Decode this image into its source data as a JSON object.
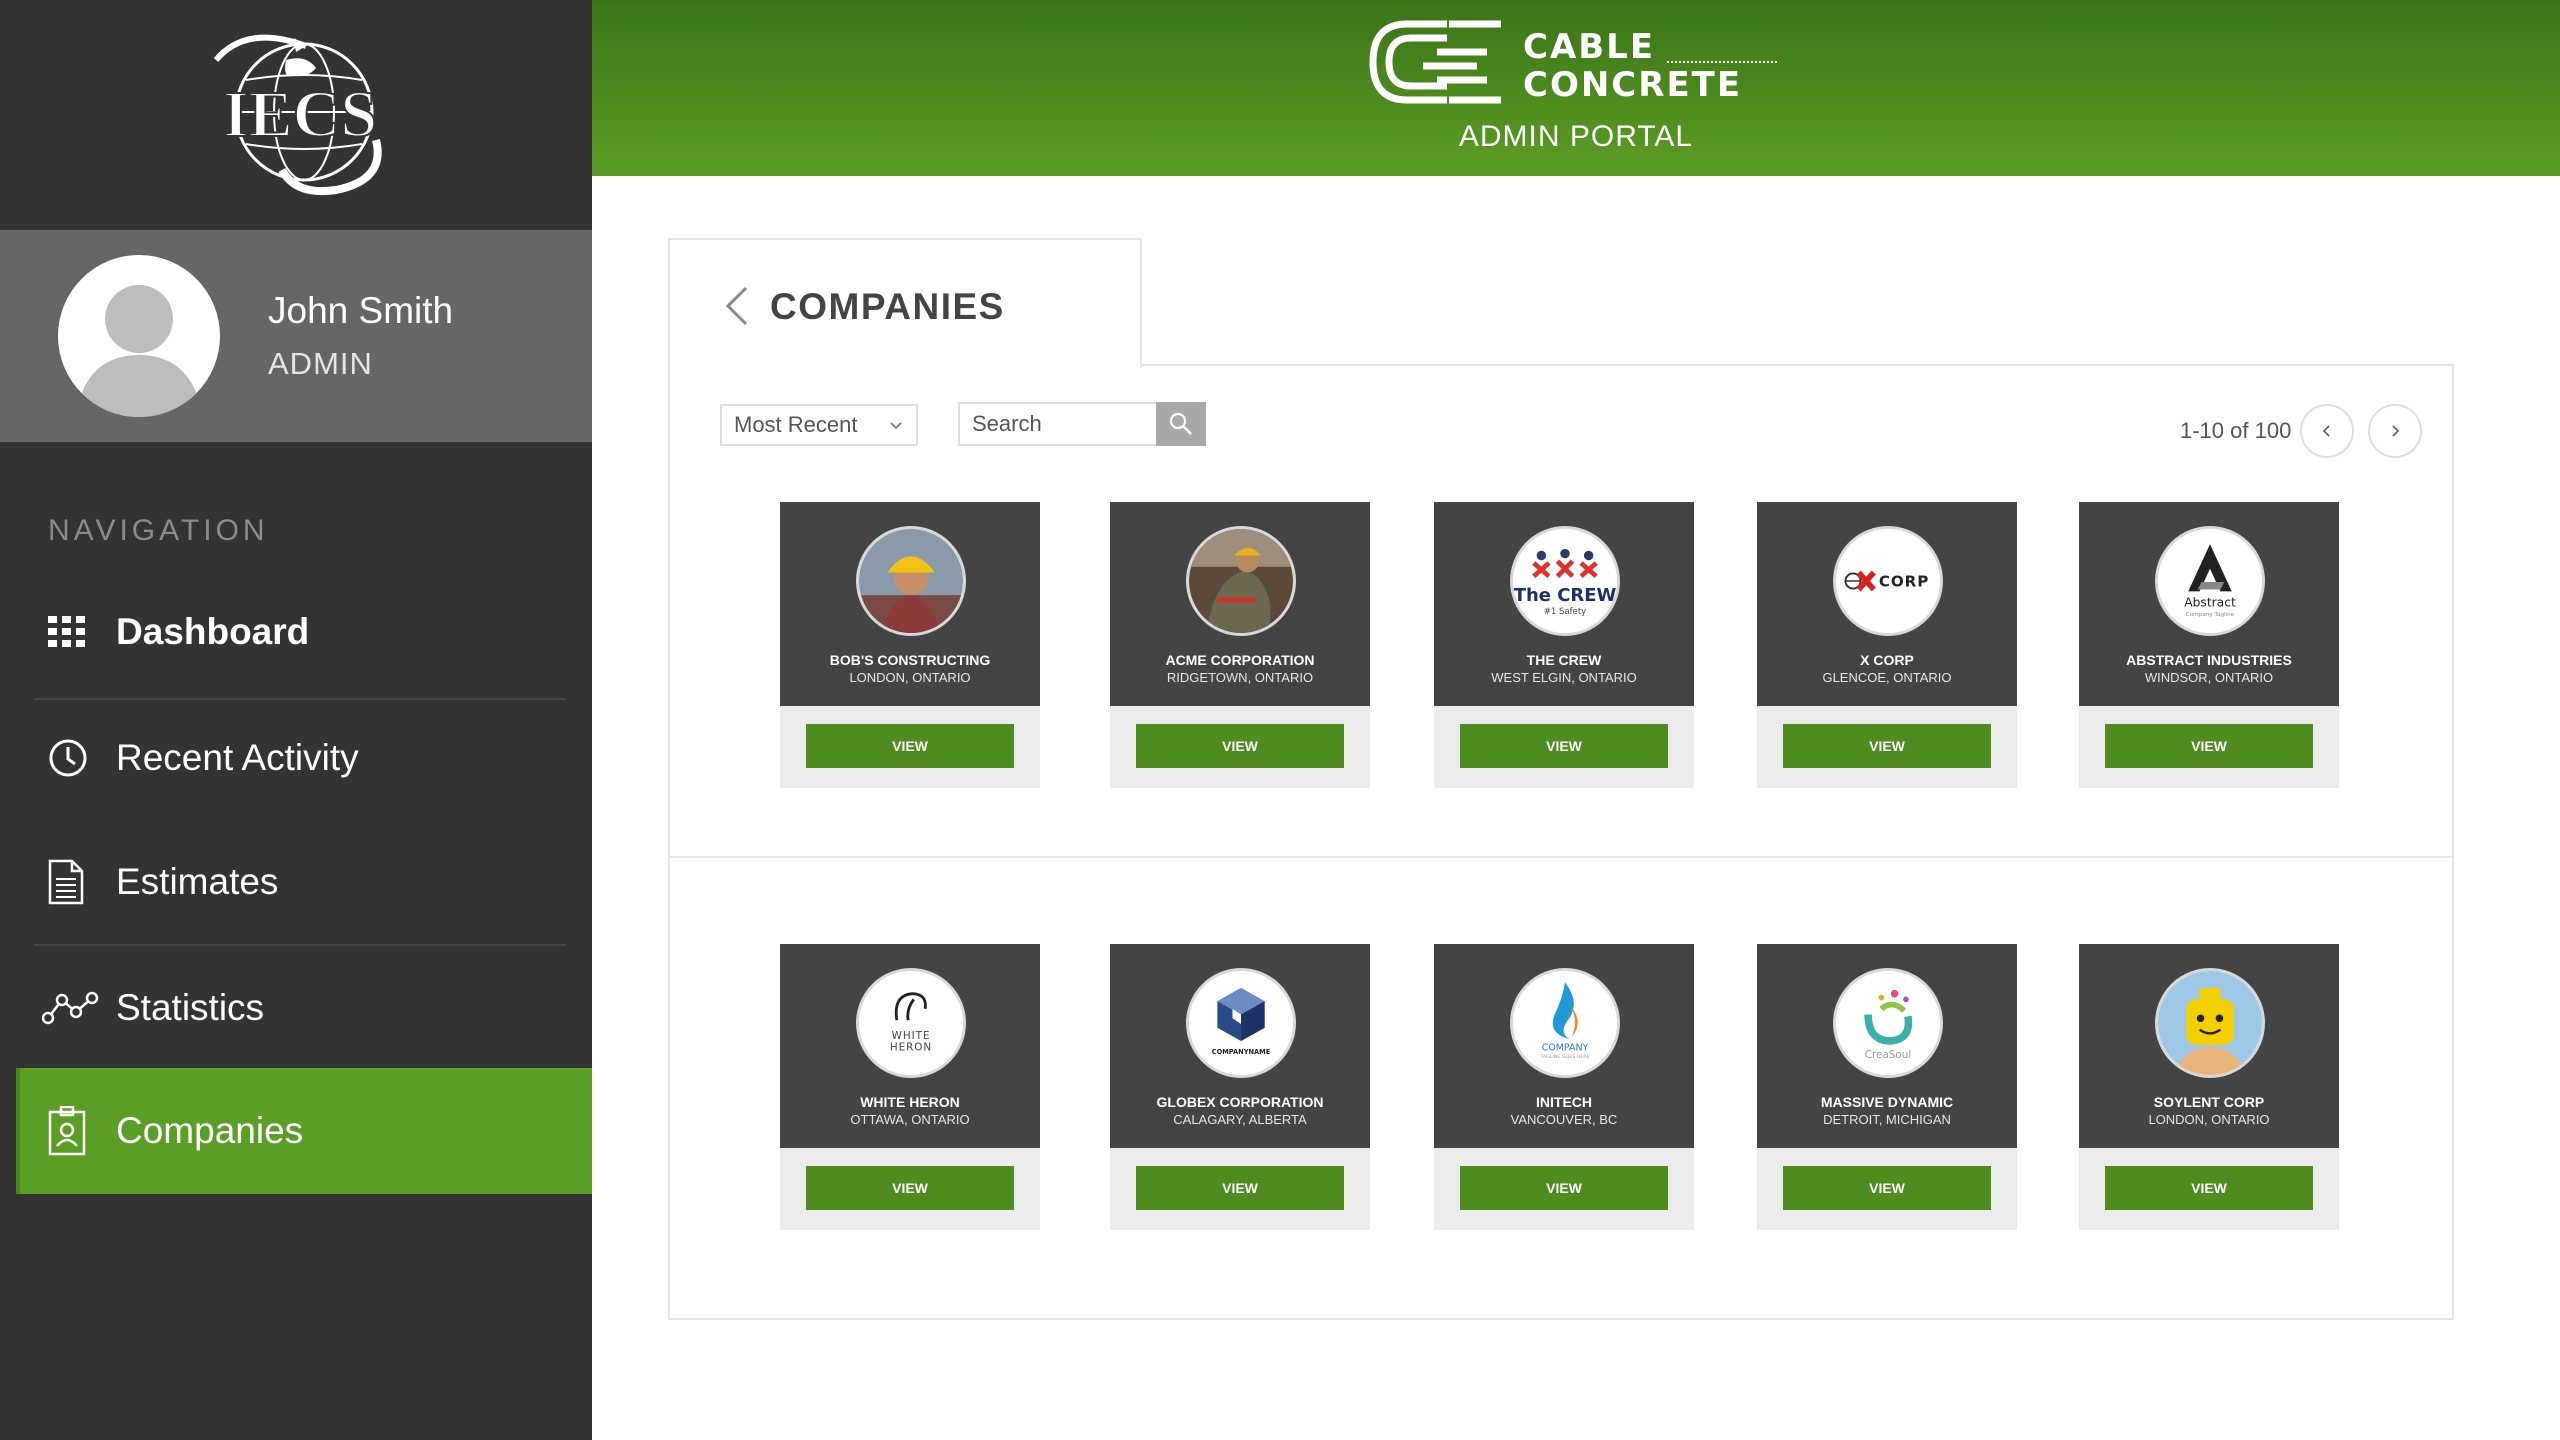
{
  "brand": {
    "org_logo_text": "IECS",
    "portal_logo_line1": "CABLE",
    "portal_logo_line2": "CONCRETE",
    "portal_subtitle": "ADMIN PORTAL",
    "accent_color": "#5a9e25",
    "header_color": "#4e8c1f",
    "sidebar_color": "#333333"
  },
  "profile": {
    "name": "John Smith",
    "role": "ADMIN"
  },
  "navigation": {
    "heading": "NAVIGATION",
    "items": [
      {
        "label": "Dashboard",
        "icon": "grid-icon"
      },
      {
        "label": "Recent Activity",
        "icon": "clock-icon"
      },
      {
        "label": "Estimates",
        "icon": "document-icon"
      },
      {
        "label": "Statistics",
        "icon": "line-chart-icon"
      },
      {
        "label": "Companies",
        "icon": "id-badge-icon",
        "active": true
      }
    ]
  },
  "page": {
    "title": "COMPANIES",
    "sort_value": "Most Recent",
    "search_placeholder": "Search",
    "pagination_text": "1-10 of 100"
  },
  "companies": [
    {
      "name": "BOB'S CONSTRUCTING",
      "location": "LONDON, ONTARIO",
      "button": "VIEW"
    },
    {
      "name": "ACME CORPORATION",
      "location": "RIDGETOWN, ONTARIO",
      "button": "VIEW"
    },
    {
      "name": "THE CREW",
      "location": "WEST ELGIN, ONTARIO",
      "button": "VIEW"
    },
    {
      "name": "X CORP",
      "location": "GLENCOE, ONTARIO",
      "button": "VIEW"
    },
    {
      "name": "ABSTRACT INDUSTRIES",
      "location": "WINDSOR, ONTARIO",
      "button": "VIEW"
    },
    {
      "name": "WHITE HERON",
      "location": "OTTAWA, ONTARIO",
      "button": "VIEW"
    },
    {
      "name": "GLOBEX CORPORATION",
      "location": "CALAGARY, ALBERTA",
      "button": "VIEW"
    },
    {
      "name": "INITECH",
      "location": "VANCOUVER, BC",
      "button": "VIEW"
    },
    {
      "name": "MASSIVE DYNAMIC",
      "location": "DETROIT, MICHIGAN",
      "button": "VIEW"
    },
    {
      "name": "SOYLENT CORP",
      "location": "LONDON, ONTARIO",
      "button": "VIEW"
    }
  ],
  "logo_texts": {
    "crew_main": "The CREW",
    "crew_sub": "#1 Safety",
    "xcorp": "CORP",
    "abstract": "Abstract",
    "abstract_sub": "Company Tagline",
    "heron_1": "WHITE",
    "heron_2": "HERON",
    "globex": "COMPANYNAME",
    "initech": "COMPANY",
    "initech_sub": "TAGLINE GOES HERE",
    "massive": "CreaSoul"
  }
}
